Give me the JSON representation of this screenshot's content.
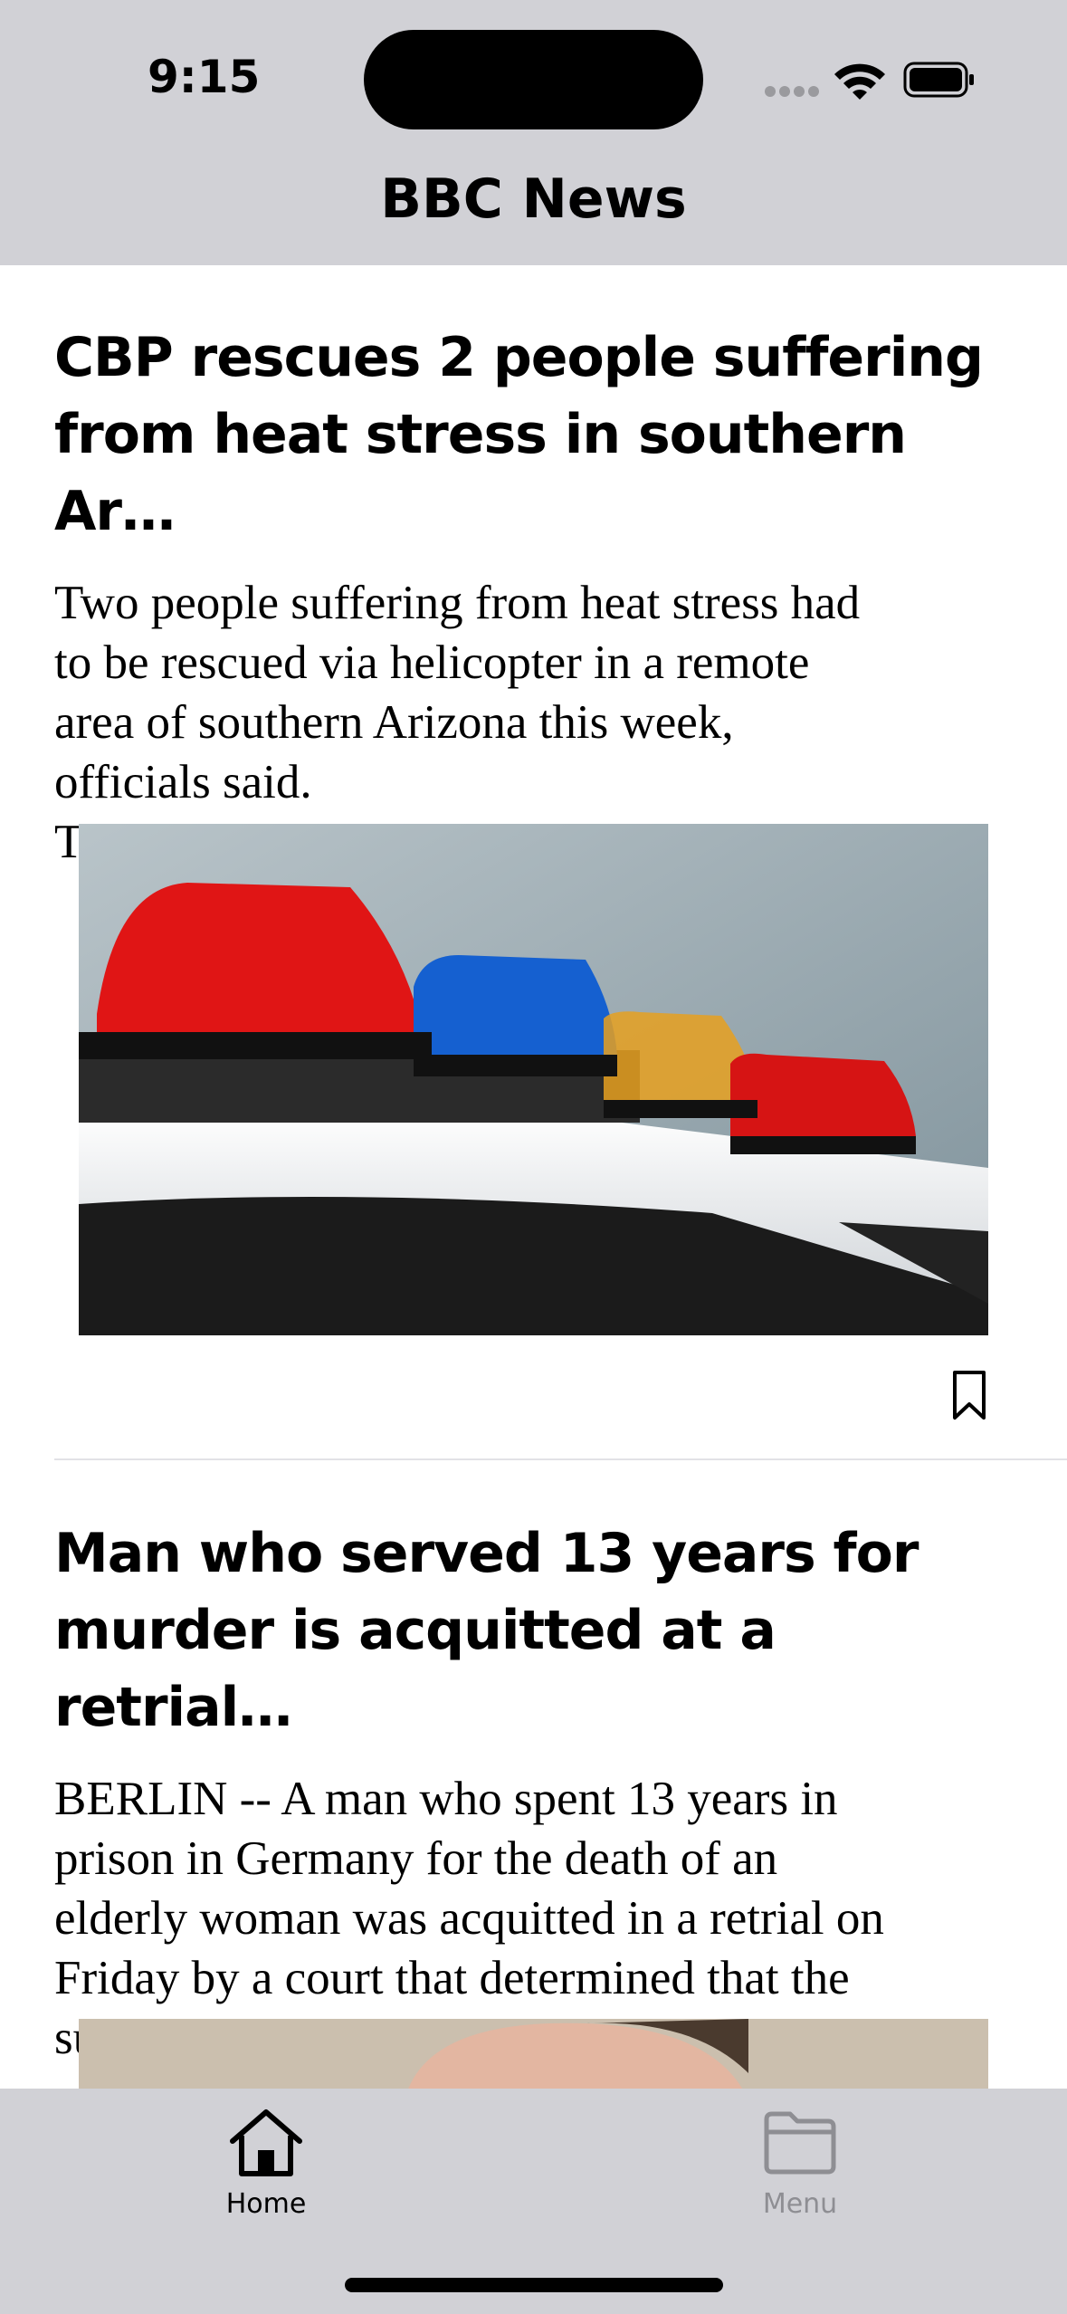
{
  "status_bar": {
    "time": "9:15"
  },
  "nav": {
    "title": "BBC News"
  },
  "articles": [
    {
      "headline_line1": "CBP rescues 2 people suffering",
      "headline_line2": "from heat stress in southern Ar…",
      "excerpt_lines": [
        "Two people suffering from heat stress had",
        "to be rescued via helicopter in a remote",
        "area of southern Arizona this week,",
        "officials said.",
        "The U.S. Customs and Border Protection…"
      ],
      "image_icon": "police-lights-photo",
      "bookmark_icon": "bookmark-icon"
    },
    {
      "headline_line1": "Man who served 13 years for",
      "headline_line2": "murder is acquitted at a retrial…",
      "excerpt_lines": [
        "BERLIN -- A man who spent 13 years in",
        "prison in Germany for the death of an",
        "elderly woman was acquitted in a retrial on",
        "Friday by a court that determined that the",
        "supposed murder victim had died in a… […"
      ],
      "image_icon": "man-portrait-photo"
    }
  ],
  "tabbar": {
    "tabs": [
      {
        "label": "Home",
        "icon": "house-icon",
        "active": true,
        "color": "#000000"
      },
      {
        "label": "Menu",
        "icon": "folder-icon",
        "active": false,
        "color": "#8e8e93"
      }
    ]
  }
}
